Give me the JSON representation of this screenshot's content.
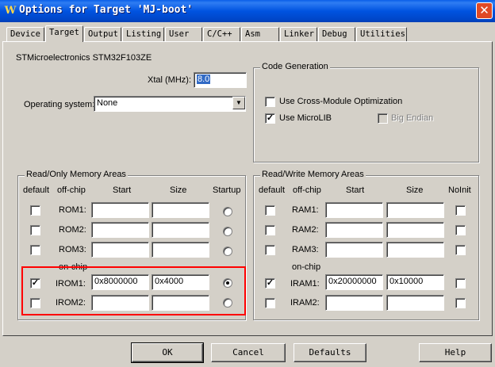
{
  "window": {
    "title": "Options for Target 'MJ-boot'",
    "icon": "W",
    "close_glyph": "✕"
  },
  "tabs": [
    "Device",
    "Target",
    "Output",
    "Listing",
    "User",
    "C/C++",
    "Asm",
    "Linker",
    "Debug",
    "Utilities"
  ],
  "active_tab": "Target",
  "device_name": "STMicroelectronics STM32F103ZE",
  "xtal": {
    "label": "Xtal (MHz):",
    "value": "8.0"
  },
  "os": {
    "label": "Operating system:",
    "value": "None"
  },
  "codegen": {
    "title": "Code Generation",
    "cross_module": {
      "label": "Use Cross-Module Optimization",
      "checked": false
    },
    "microlib": {
      "label": "Use MicroLIB",
      "checked": true
    },
    "big_endian": {
      "label": "Big Endian",
      "checked": false,
      "disabled": true
    }
  },
  "rom": {
    "title": "Read/Only Memory Areas",
    "headers": {
      "default": "default",
      "offchip": "off-chip",
      "start": "Start",
      "size": "Size",
      "startup": "Startup"
    },
    "onchip_label": "on-chip",
    "rows": [
      {
        "label": "ROM1:",
        "default": false,
        "start": "",
        "size": "",
        "startup": false
      },
      {
        "label": "ROM2:",
        "default": false,
        "start": "",
        "size": "",
        "startup": false
      },
      {
        "label": "ROM3:",
        "default": false,
        "start": "",
        "size": "",
        "startup": false
      },
      {
        "label": "IROM1:",
        "default": true,
        "start": "0x8000000",
        "size": "0x4000",
        "startup": true
      },
      {
        "label": "IROM2:",
        "default": false,
        "start": "",
        "size": "",
        "startup": false
      }
    ]
  },
  "ram": {
    "title": "Read/Write Memory Areas",
    "headers": {
      "default": "default",
      "offchip": "off-chip",
      "start": "Start",
      "size": "Size",
      "noinit": "NoInit"
    },
    "onchip_label": "on-chip",
    "rows": [
      {
        "label": "RAM1:",
        "default": false,
        "start": "",
        "size": "",
        "noinit": false
      },
      {
        "label": "RAM2:",
        "default": false,
        "start": "",
        "size": "",
        "noinit": false
      },
      {
        "label": "RAM3:",
        "default": false,
        "start": "",
        "size": "",
        "noinit": false
      },
      {
        "label": "IRAM1:",
        "default": true,
        "start": "0x20000000",
        "size": "0x10000",
        "noinit": false
      },
      {
        "label": "IRAM2:",
        "default": false,
        "start": "",
        "size": "",
        "noinit": false
      }
    ]
  },
  "buttons": {
    "ok": "OK",
    "cancel": "Cancel",
    "defaults": "Defaults",
    "help": "Help"
  },
  "highlight_color": "#ff0000"
}
